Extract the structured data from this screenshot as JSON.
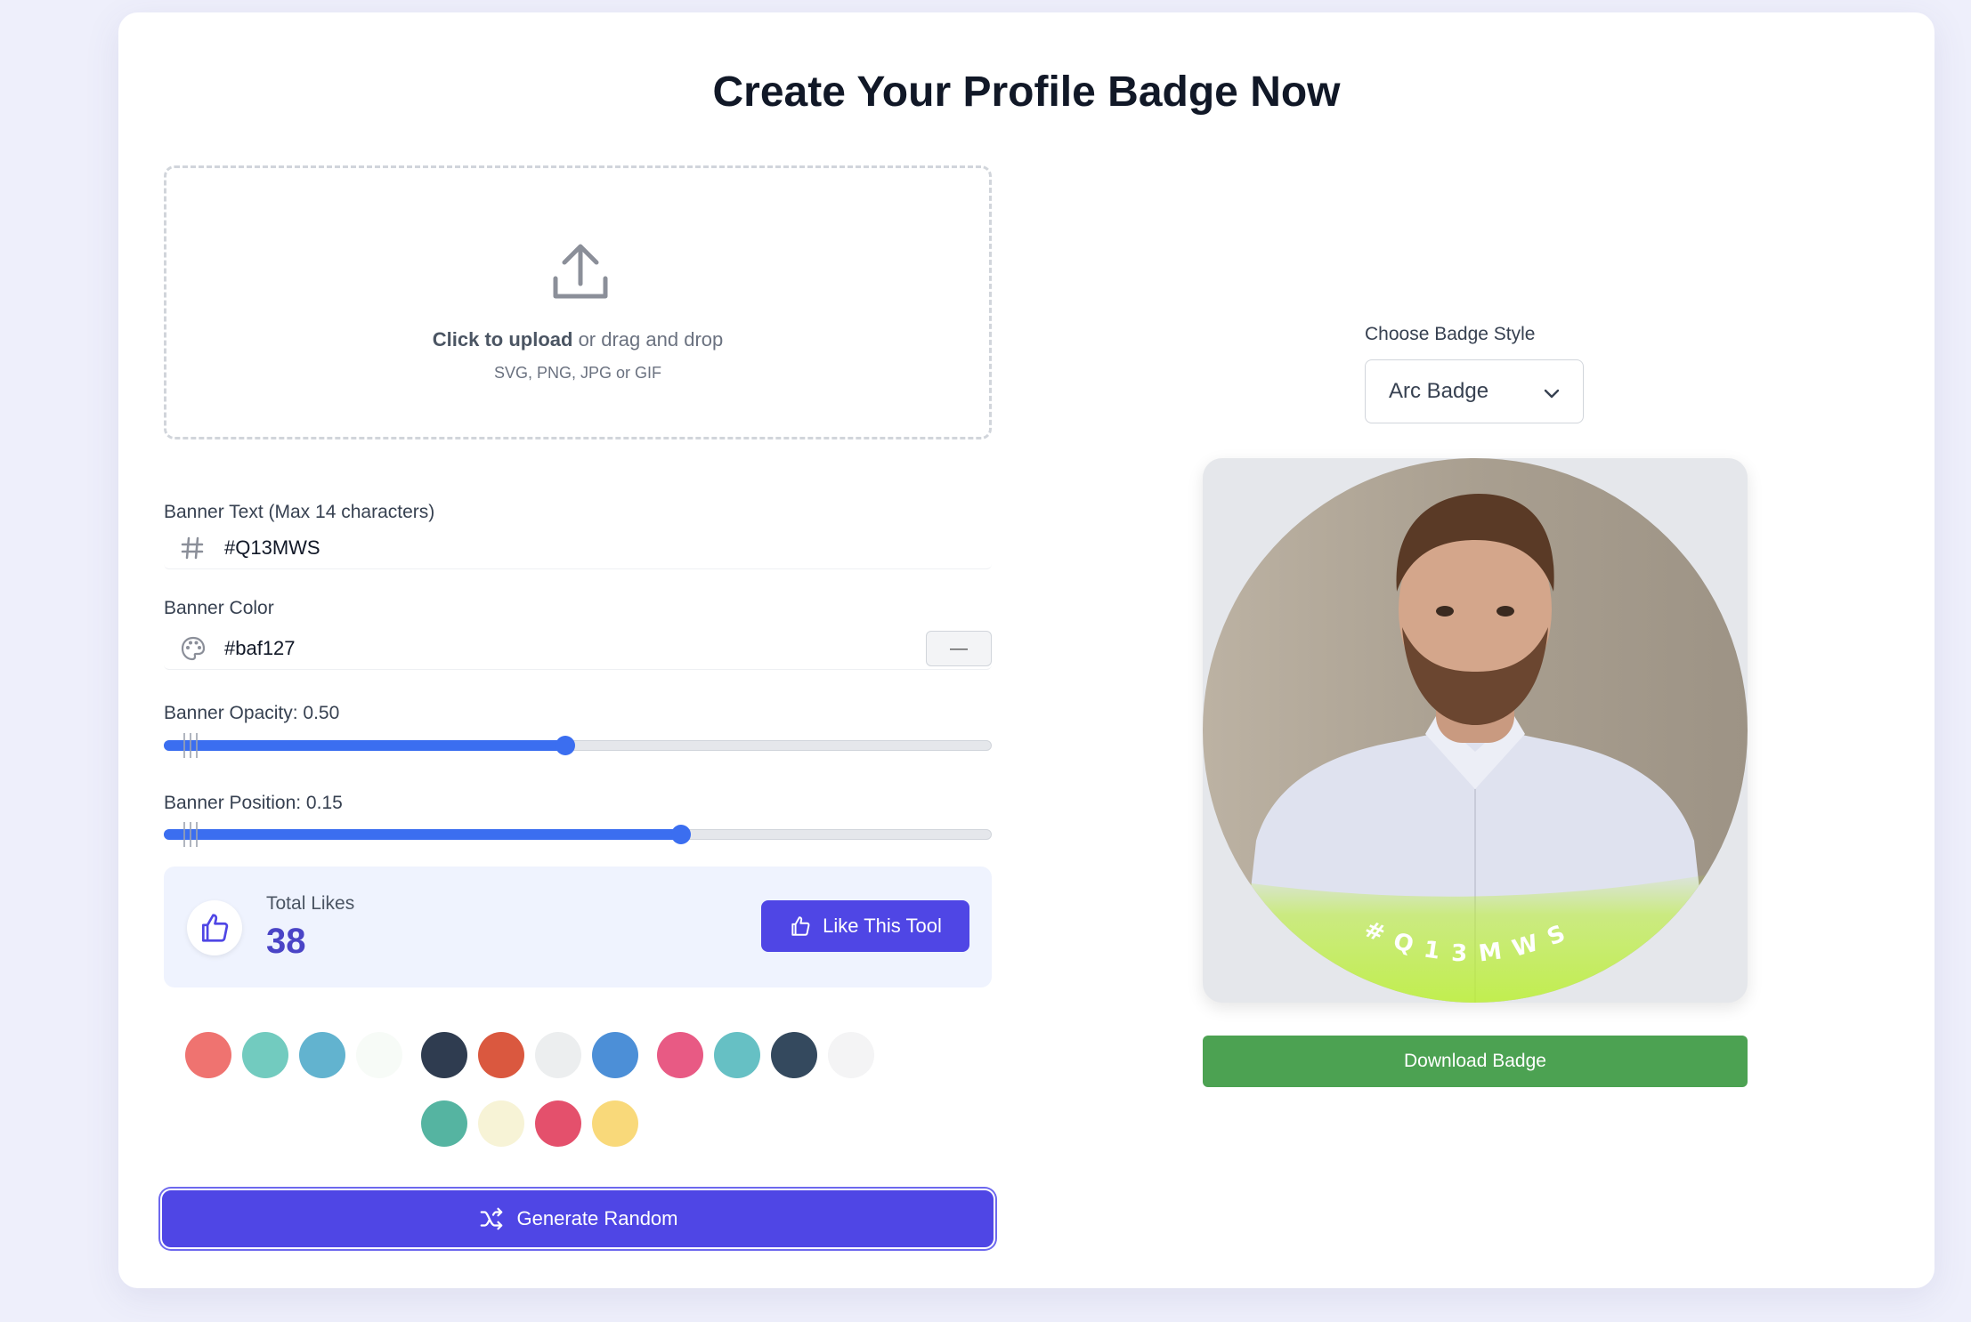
{
  "page": {
    "title": "Create Your Profile Badge Now"
  },
  "upload": {
    "icon": "upload-icon",
    "cta_bold": "Click to upload",
    "cta_rest": " or drag and drop",
    "formats": "SVG, PNG, JPG or GIF"
  },
  "banner_text": {
    "label": "Banner Text (Max 14 characters)",
    "icon": "hash-icon",
    "value": "#Q13MWS"
  },
  "banner_color": {
    "label": "Banner Color",
    "icon": "palette-icon",
    "value": "#baf127",
    "button_label": "—"
  },
  "banner_opacity": {
    "label": "Banner Opacity: 0.50",
    "value": 0.5,
    "fill_fraction": 0.485
  },
  "banner_position": {
    "label": "Banner Position: 0.15",
    "value": 0.15,
    "fill_fraction": 0.625
  },
  "likes": {
    "icon": "thumbs-up-icon",
    "label": "Total Likes",
    "count": "38",
    "button_label": "Like This Tool"
  },
  "palette": {
    "row1": [
      "#ef7370",
      "#72cbbf",
      "#62b3cf",
      "#f7fbf7",
      "#2f3c50",
      "#da583f",
      "#eceeef",
      "#4c8fd7",
      "#e85a84",
      "#66c0c4",
      "#34495e",
      "#f4f4f5"
    ],
    "row2": [
      "#55b4a1",
      "#f7f3d6",
      "#e4506c",
      "#f9d97a"
    ]
  },
  "generate": {
    "icon": "shuffle-icon",
    "label": "Generate Random"
  },
  "badge_style": {
    "label": "Choose Badge Style",
    "selected": "Arc Badge",
    "icon": "chevron-down-icon"
  },
  "preview": {
    "banner_letters": [
      "#",
      "Q",
      "1",
      "3",
      "M",
      "W",
      "S"
    ],
    "banner_color": "#baf127"
  },
  "download": {
    "label": "Download Badge"
  },
  "colors": {
    "accent": "#4f46e5",
    "slider": "#3b6ef0",
    "download": "#4ca252"
  }
}
